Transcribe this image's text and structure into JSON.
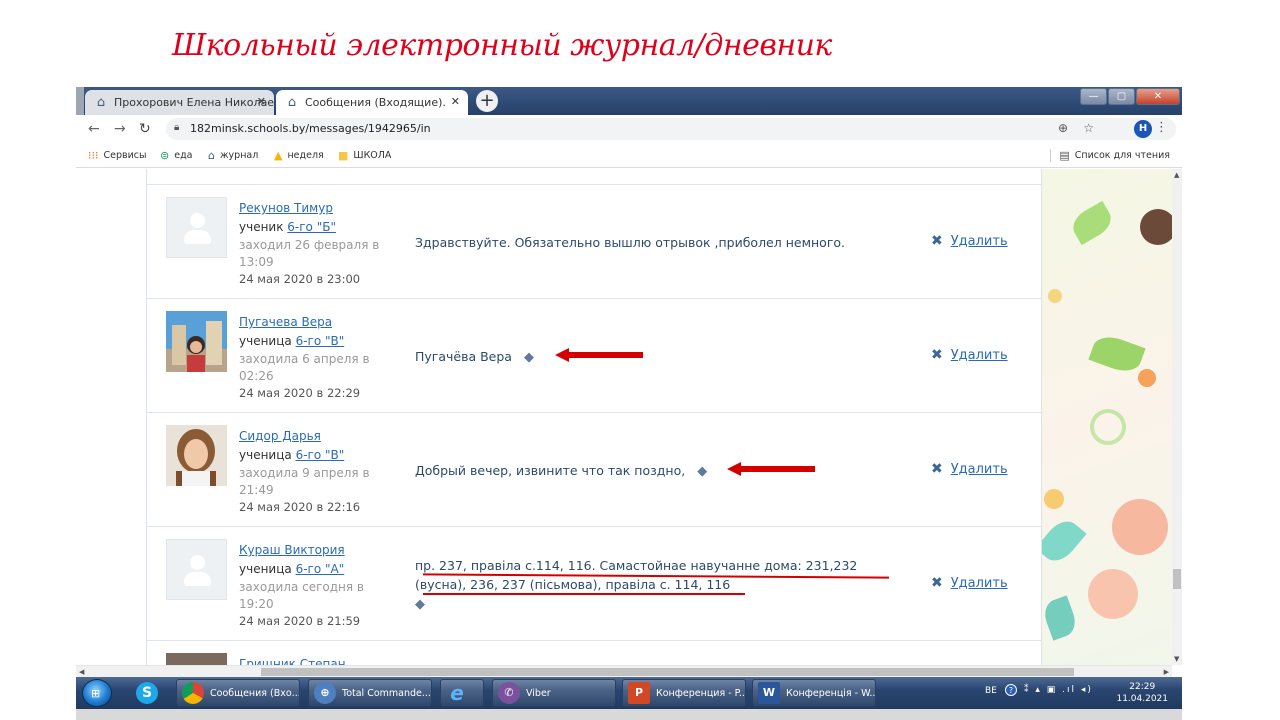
{
  "slide": {
    "title": "Школьный электронный журнал/дневник"
  },
  "tabs": [
    {
      "label": "Прохорович Елена Николаевна",
      "close": "✕"
    },
    {
      "label": "Сообщения (Входящие). Прохор",
      "close": "✕"
    }
  ],
  "new_tab": "+",
  "window_buttons": {
    "minimize": "—",
    "maximize": "▢",
    "close": "✕"
  },
  "address": {
    "url": "182minsk.schools.by/messages/1942965/in",
    "profile_initial": "Н"
  },
  "bookmarks": [
    {
      "label": "Сервисы",
      "icon": "apps-icon"
    },
    {
      "label": "еда",
      "icon": "food-icon"
    },
    {
      "label": "журнал",
      "icon": "school-icon"
    },
    {
      "label": "неделя",
      "icon": "drive-icon"
    },
    {
      "label": "ШКОЛА",
      "icon": "folder-icon"
    }
  ],
  "reading_list": "Список для чтения",
  "messages": [
    {
      "name": "Рекунов Тимур",
      "role": "ученик ",
      "class": "6-го \"Б\"",
      "seen": "заходил 26 февраля в 13:09",
      "date": "24 мая 2020 в 23:00",
      "text": "Здравствуйте. Обязательно вышлю отрывок ,приболел немного.",
      "delete": "Удалить"
    },
    {
      "name": "Пугачева Вера",
      "role": "ученица ",
      "class": "6-го \"В\"",
      "seen": "заходила 6 апреля в 02:26",
      "date": "24 мая 2020 в 22:29",
      "text": "Пугачёва Вера",
      "delete": "Удалить"
    },
    {
      "name": "Сидор Дарья",
      "role": "ученица ",
      "class": "6-го \"В\"",
      "seen": "заходила 9 апреля в 21:49",
      "date": "24 мая 2020 в 22:16",
      "text": "Добрый вечер, извините что так поздно,",
      "delete": "Удалить"
    },
    {
      "name": "Кураш Виктория",
      "role": "ученица ",
      "class": "6-го \"А\"",
      "seen": "заходила сегодня в 19:20",
      "date": "24 мая 2020 в 21:59",
      "text_line1": "пр. 237, правіла с.114, 116. Самастойнае навучанне дома: 231,232",
      "text_line2": "(вусна), 236, 237 (пісьмова), правіла с. 114, 116",
      "delete": "Удалить"
    },
    {
      "name": "Грищник Степан"
    }
  ],
  "taskbar": {
    "items": [
      {
        "label": "Сообщения (Вхо...",
        "color": "#dd4b39"
      },
      {
        "label": "Total Commande...",
        "color": "#4e7fbf"
      },
      {
        "label": "",
        "color": "#1b7fd6"
      },
      {
        "label": "Viber",
        "color": "#7b519d"
      },
      {
        "label": "Конференция - P...",
        "color": "#d24726"
      },
      {
        "label": "Конференція - W...",
        "color": "#2b579a"
      }
    ],
    "tray": {
      "lang": "BE",
      "help": "?",
      "time": "22:29",
      "date": "11.04.2021"
    }
  },
  "colors": {
    "accent": "#2a6bb6",
    "annotation": "#d40000"
  }
}
